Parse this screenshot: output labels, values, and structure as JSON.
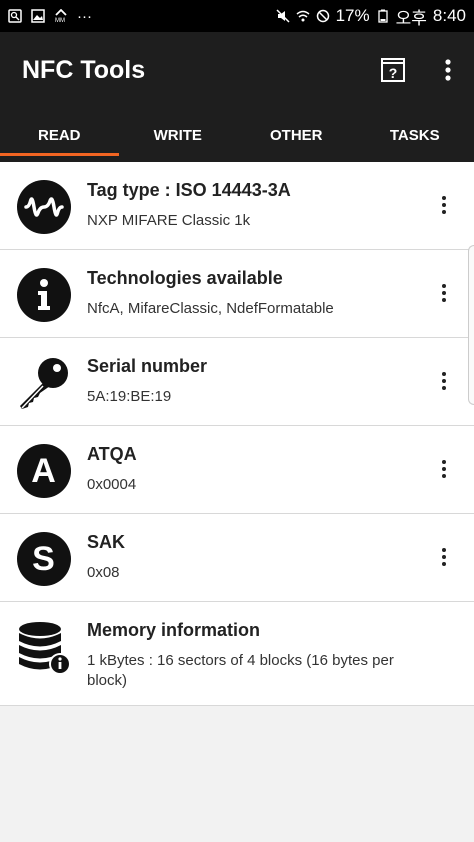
{
  "status_bar": {
    "battery": "17%",
    "time_label": "오후",
    "time": "8:40",
    "icons": [
      "screenshot-icon",
      "gallery-icon",
      "mm-icon",
      "more-dots-icon",
      "mute-icon",
      "wifi-icon",
      "no-signal-icon",
      "battery-icon"
    ]
  },
  "app_bar": {
    "title": "NFC Tools",
    "help_icon": "help-book-icon",
    "menu_icon": "overflow-menu-icon"
  },
  "tabs": [
    {
      "label": "READ",
      "active": true
    },
    {
      "label": "WRITE",
      "active": false
    },
    {
      "label": "OTHER",
      "active": false
    },
    {
      "label": "TASKS",
      "active": false
    }
  ],
  "accent_color": "#f26522",
  "items": [
    {
      "title": "Tag type : ISO 14443-3A",
      "subtitle": "NXP MIFARE Classic 1k",
      "icon": "wave-icon"
    },
    {
      "title": "Technologies available",
      "subtitle": "NfcA, MifareClassic, NdefFormatable",
      "icon": "info-icon"
    },
    {
      "title": "Serial number",
      "subtitle": "5A:19:BE:19",
      "icon": "key-icon"
    },
    {
      "title": "ATQA",
      "subtitle": "0x0004",
      "icon": "letter-a-icon",
      "glyph": "A"
    },
    {
      "title": "SAK",
      "subtitle": "0x08",
      "icon": "letter-s-icon",
      "glyph": "S"
    },
    {
      "title": "Memory information",
      "subtitle": "1 kBytes : 16 sectors of 4 blocks (16 bytes per block)",
      "icon": "database-info-icon"
    }
  ]
}
